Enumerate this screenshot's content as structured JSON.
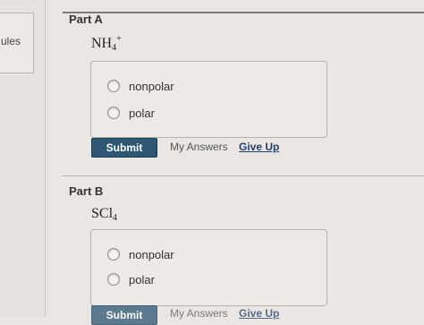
{
  "sidebar": {
    "partial_text": "ules"
  },
  "partA": {
    "title": "Part A",
    "formula": {
      "base": "NH",
      "sub": "4",
      "sup": "+"
    },
    "options": [
      {
        "label": "nonpolar"
      },
      {
        "label": "polar"
      }
    ],
    "submit_label": "Submit",
    "my_answers_label": "My Answers",
    "give_up_label": "Give Up"
  },
  "partB": {
    "title": "Part B",
    "formula": {
      "base": "SCl",
      "sub": "4"
    },
    "options": [
      {
        "label": "nonpolar"
      },
      {
        "label": "polar"
      }
    ],
    "submit_label": "Submit",
    "my_answers_label": "My Answers",
    "give_up_label": "Give Up"
  },
  "colors": {
    "submit_bg": "#2d5774",
    "link": "#21416a"
  }
}
